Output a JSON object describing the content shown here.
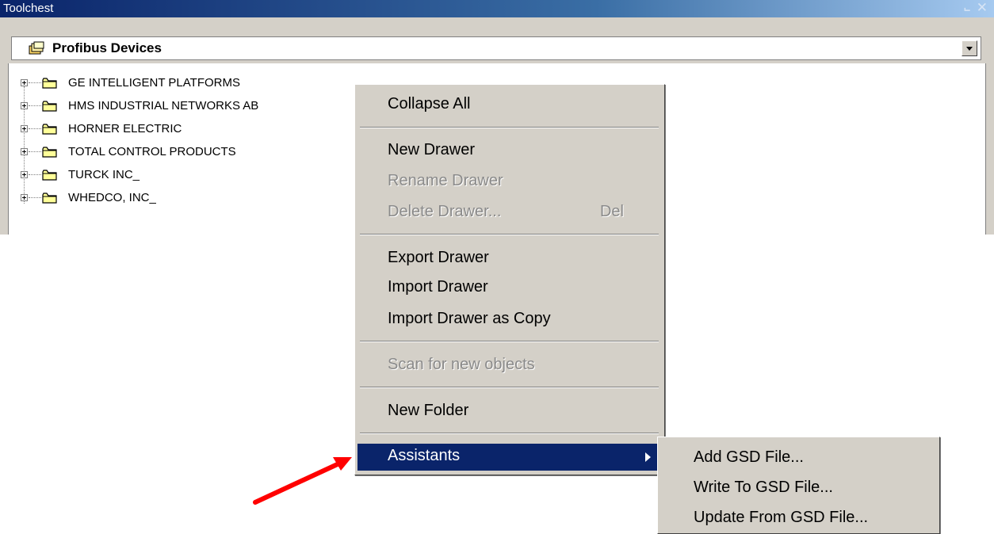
{
  "window": {
    "title": "Toolchest",
    "pin_glyph": "ᵖ",
    "close_glyph": "✕"
  },
  "dropdown": {
    "selected": "Profibus Devices",
    "icon": "drawer-icon"
  },
  "tree": {
    "items": [
      {
        "label": "GE INTELLIGENT PLATFORMS"
      },
      {
        "label": "HMS INDUSTRIAL NETWORKS AB"
      },
      {
        "label": "HORNER ELECTRIC"
      },
      {
        "label": "TOTAL CONTROL PRODUCTS"
      },
      {
        "label": "TURCK INC_"
      },
      {
        "label": "WHEDCO, INC_"
      }
    ]
  },
  "context_menu": {
    "items": [
      {
        "label": "Collapse All",
        "enabled": true
      },
      {
        "label": "New Drawer",
        "enabled": true
      },
      {
        "label": "Rename Drawer",
        "enabled": false
      },
      {
        "label": "Delete Drawer...",
        "accel": "Del",
        "enabled": false
      },
      {
        "label": "Export Drawer",
        "enabled": true
      },
      {
        "label": "Import Drawer",
        "enabled": true
      },
      {
        "label": "Import Drawer as Copy",
        "enabled": true
      },
      {
        "label": "Scan for new objects",
        "enabled": false
      },
      {
        "label": "New Folder",
        "enabled": true
      },
      {
        "label": "Assistants",
        "enabled": true,
        "highlighted": true,
        "has_submenu": true
      }
    ]
  },
  "submenu": {
    "items": [
      {
        "label": "Add GSD File..."
      },
      {
        "label": "Write To GSD File..."
      },
      {
        "label": "Update From GSD File..."
      }
    ]
  },
  "colors": {
    "menu_bg": "#d4d0c8",
    "highlight": "#0a246a",
    "annotation_arrow": "#ff0000",
    "folder": "#ffff99"
  }
}
